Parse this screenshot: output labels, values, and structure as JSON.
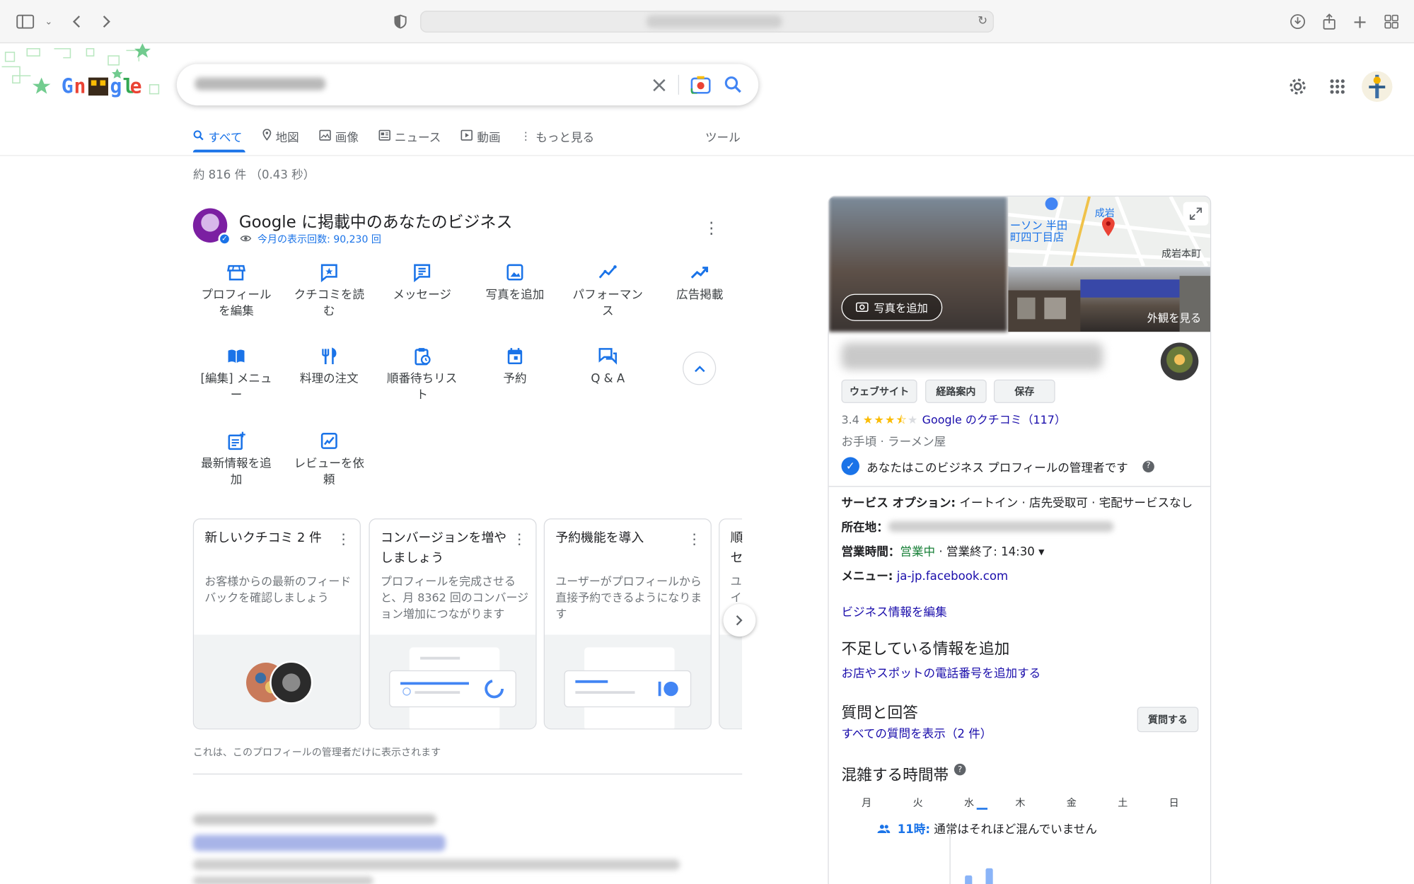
{
  "browser": {
    "url_blurred": true
  },
  "search": {
    "clear_label": "×"
  },
  "tabs": [
    {
      "label": "すべて",
      "icon": "search-icon"
    },
    {
      "label": "地図",
      "icon": "map-pin-icon"
    },
    {
      "label": "画像",
      "icon": "image-icon"
    },
    {
      "label": "ニュース",
      "icon": "news-icon"
    },
    {
      "label": "動画",
      "icon": "video-icon"
    },
    {
      "label": "もっと見る",
      "icon": "more-vert-icon"
    }
  ],
  "tools_label": "ツール",
  "stats": "約 816 件 （0.43 秒）",
  "business": {
    "title": "Google に掲載中のあなたのビジネス",
    "views": "今月の表示回数: 90,230 回",
    "actions": [
      {
        "label": "プロフィール\nを編集",
        "icon": "store-icon"
      },
      {
        "label": "クチコミを読\nむ",
        "icon": "review-icon"
      },
      {
        "label": "メッセージ",
        "icon": "message-icon"
      },
      {
        "label": "写真を追加",
        "icon": "photo-icon"
      },
      {
        "label": "パフォーマン\nス",
        "icon": "performance-icon"
      },
      {
        "label": "広告掲載",
        "icon": "trend-icon"
      },
      {
        "label": "[編集] メニュ\nー",
        "icon": "menu-book-icon"
      },
      {
        "label": "料理の注文",
        "icon": "utensils-icon"
      },
      {
        "label": "順番待ちリス\nト",
        "icon": "waitlist-icon"
      },
      {
        "label": "予約",
        "icon": "calendar-icon"
      },
      {
        "label": "Q & A",
        "icon": "qa-icon"
      },
      {
        "label": "最新情報を追\n加",
        "icon": "post-add-icon"
      },
      {
        "label": "レビューを依\n頼",
        "icon": "request-review-icon"
      }
    ]
  },
  "cards": [
    {
      "title": "新しいクチコミ 2 件",
      "body": "お客様からの最新のフィードバックを確認しましょう"
    },
    {
      "title": "コンバージョンを増やしましょう",
      "body": "プロフィールを完成させると、月 8362 回のコンバージョン増加につながります"
    },
    {
      "title": "予約機能を導入",
      "body": "ユーザーがプロフィールから直接予約できるようになります"
    },
    {
      "title": "順\nセ",
      "body": "ユ\nイ"
    }
  ],
  "admin_note": "これは、このプロフィールの管理者だけに表示されます",
  "panel": {
    "add_photo": "写真を追加",
    "see_outside": "外観を見る",
    "map_labels": [
      "ーソン 半田",
      "町四丁目店",
      "成岩",
      "成岩本町"
    ],
    "buttons": [
      "ウェブサイト",
      "経路案内",
      "保存"
    ],
    "rating": "3.4",
    "reviews_link": "Google のクチコミ（117）",
    "category": "お手頃 · ラーメン屋",
    "owner": "あなたはこのビジネス プロフィールの管理者です",
    "service_label": "サービス オプション:",
    "service_value": " イートイン · 店先受取可 · 宅配サービスなし",
    "address_label": "所在地：",
    "hours_label": "営業時間：",
    "hours_open": "営業中",
    "hours_rest": " · 営業終了: 14:30 ▾",
    "menu_label": "メニュー:",
    "menu_link": "ja-jp.facebook.com",
    "edit_link": "ビジネス情報を編集",
    "missing_heading": "不足している情報を追加",
    "missing_link": "お店やスポットの電話番号を追加する",
    "qa_heading": "質問と回答",
    "qa_link": "すべての質問を表示（2 件）",
    "ask_label": "質問する",
    "popular_heading": "混雑する時間帯",
    "days": [
      "月",
      "火",
      "水",
      "木",
      "金",
      "土",
      "日"
    ],
    "busy_time": "11時:",
    "busy_text": " 通常はそれほど混んでいません"
  }
}
